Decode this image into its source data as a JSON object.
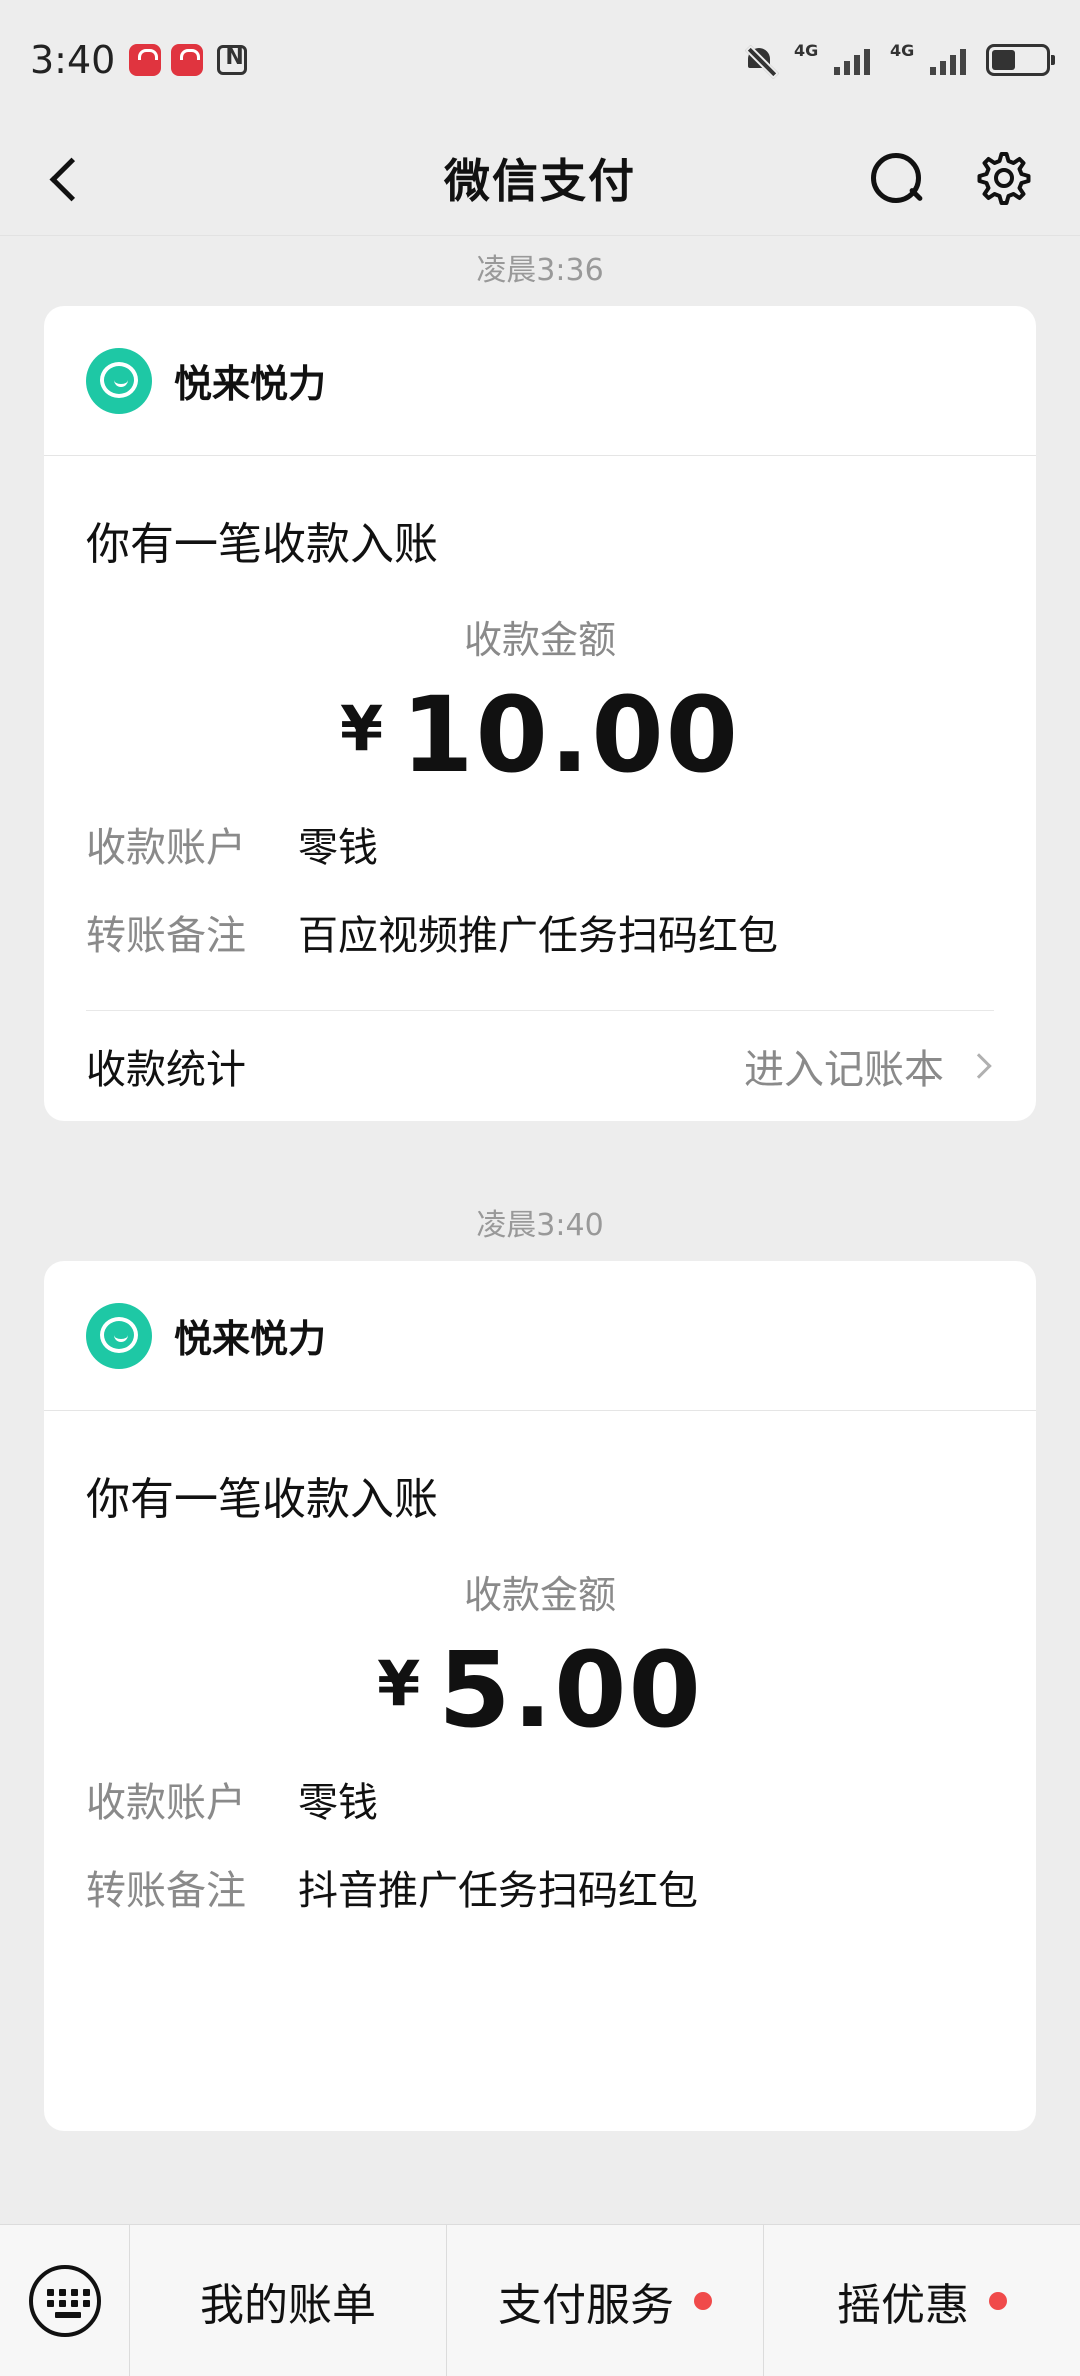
{
  "status_bar": {
    "time": "3:40",
    "network_1": "4G",
    "network_2": "4G"
  },
  "header": {
    "title": "微信支付"
  },
  "messages": [
    {
      "timestamp": "凌晨3:36",
      "merchant": "悦来悦力",
      "notice": "你有一笔收款入账",
      "amount_label": "收款金额",
      "currency": "¥",
      "amount": "10.00",
      "account_key": "收款账户",
      "account_value": "零钱",
      "remark_key": "转账备注",
      "remark_value": "百应视频推广任务扫码红包",
      "stats_label": "收款统计",
      "ledger_link": "进入记账本"
    },
    {
      "timestamp": "凌晨3:40",
      "merchant": "悦来悦力",
      "notice": "你有一笔收款入账",
      "amount_label": "收款金额",
      "currency": "¥",
      "amount": "5.00",
      "account_key": "收款账户",
      "account_value": "零钱",
      "remark_key": "转账备注",
      "remark_value": "抖音推广任务扫码红包"
    }
  ],
  "bottom_bar": {
    "tabs": [
      "我的账单",
      "支付服务",
      "摇优惠"
    ]
  },
  "colors": {
    "accent": "#1ec8a5",
    "badge": "#f04a4a",
    "background": "#ededed"
  }
}
